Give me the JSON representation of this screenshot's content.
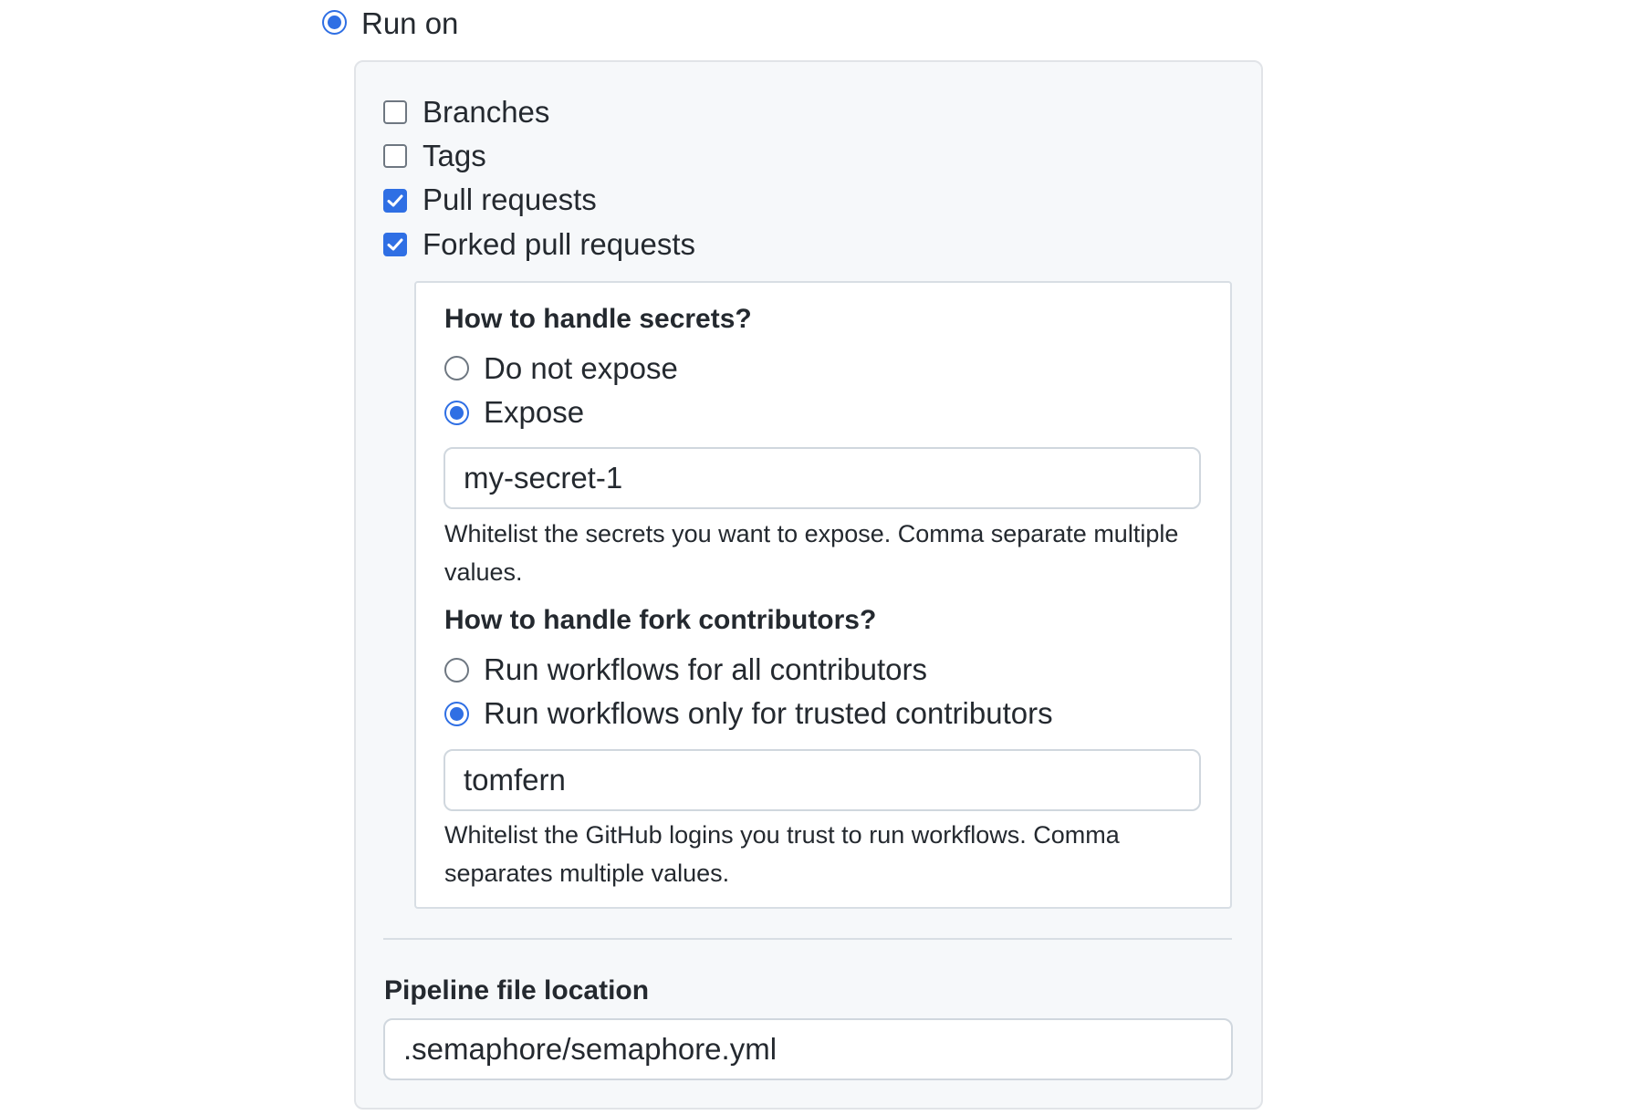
{
  "run_on": {
    "label": "Run on",
    "selected": true
  },
  "triggers": [
    {
      "label": "Branches",
      "checked": false
    },
    {
      "label": "Tags",
      "checked": false
    },
    {
      "label": "Pull requests",
      "checked": true
    },
    {
      "label": "Forked pull requests",
      "checked": true
    }
  ],
  "secrets": {
    "heading": "How to handle secrets?",
    "options": [
      {
        "label": "Do not expose",
        "selected": false
      },
      {
        "label": "Expose",
        "selected": true
      }
    ],
    "input_value": "my-secret-1",
    "help": "Whitelist the secrets you want to expose. Comma separate multiple values."
  },
  "contributors": {
    "heading": "How to handle fork contributors?",
    "options": [
      {
        "label": "Run workflows for all contributors",
        "selected": false
      },
      {
        "label": "Run workflows only for trusted contributors",
        "selected": true
      }
    ],
    "input_value": "tomfern",
    "help": "Whitelist the GitHub logins you trust to run workflows. Comma separates multiple values."
  },
  "pipeline": {
    "heading": "Pipeline file location",
    "input_value": ".semaphore/semaphore.yml"
  },
  "colors": {
    "accent": "#2f6fe4",
    "panel_bg": "#f6f8fa",
    "border": "#d0d7de"
  }
}
